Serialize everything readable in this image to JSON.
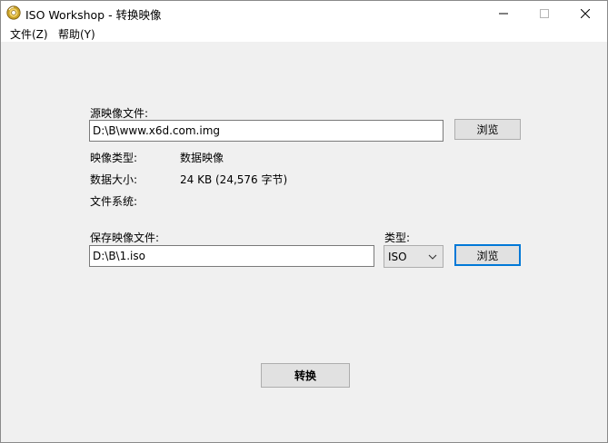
{
  "window": {
    "title": "ISO Workshop - 转换映像"
  },
  "menu": {
    "file": "文件(Z)",
    "help": "帮助(Y)"
  },
  "source": {
    "label": "源映像文件:",
    "value": "D:\\B\\www.x6d.com.img",
    "browse": "浏览"
  },
  "info": {
    "type_label": "映像类型:",
    "type_value": "数据映像",
    "size_label": "数据大小:",
    "size_value": "24 KB (24,576 字节)",
    "fs_label": "文件系统:",
    "fs_value": ""
  },
  "save": {
    "label": "保存映像文件:",
    "value": "D:\\B\\1.iso",
    "type_label": "类型:",
    "type_value": "ISO",
    "browse": "浏览"
  },
  "convert": {
    "label": "转换"
  },
  "colors": {
    "focus_border": "#0078d7",
    "button_bg": "#e1e1e1",
    "window_bg": "#f0f0f0"
  }
}
